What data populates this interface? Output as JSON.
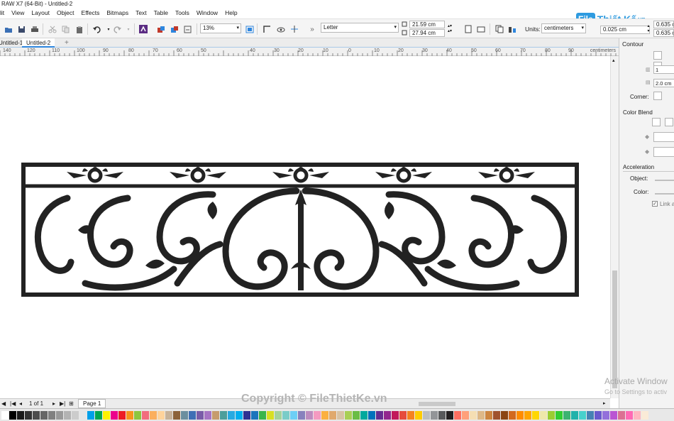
{
  "window": {
    "title": "RAW X7 (64-Bit) - Untitled-2"
  },
  "menu": [
    "lit",
    "View",
    "Layout",
    "Object",
    "Effects",
    "Bitmaps",
    "Text",
    "Table",
    "Tools",
    "Window",
    "Help"
  ],
  "toolbar": {
    "zoom": "13%",
    "paper_size": "Letter",
    "page_width": "21.59 cm",
    "page_height": "27.94 cm",
    "units_label": "Units:",
    "units_value": "centimeters",
    "nudge": "0.025 cm",
    "dup_x": "0.635 cm",
    "dup_y": "0.635 cm",
    "icons": [
      "open-icon",
      "save-icon",
      "print-icon",
      "cut-icon",
      "copy-icon",
      "paste-icon",
      "undo-icon",
      "redo-icon",
      "corel-connect-icon",
      "import-icon",
      "export-icon",
      "publish-pdf-icon",
      "full-screen-icon"
    ]
  },
  "tabs": [
    "Untitled-1",
    "Untitled-2"
  ],
  "ruler": {
    "labels": [
      "140",
      "120",
      "110",
      "100",
      "90",
      "80",
      "70",
      "60",
      "50",
      "40",
      "30",
      "20",
      "10",
      "0",
      "10",
      "20",
      "30",
      "40",
      "50",
      "60",
      "70",
      "80",
      "90"
    ],
    "unit": "centimeters"
  },
  "panel": {
    "title": "Contour",
    "steps": "1",
    "offset": "2.0 cm",
    "corner_label": "Corner:",
    "color_blend_label": "Color Blend",
    "acceleration_label": "Acceleration",
    "object_label": "Object:",
    "color_label": "Color:",
    "link_label": "Link a"
  },
  "pagebar": {
    "page_count": "1 of 1",
    "page_tab": "Page 1"
  },
  "watermark": {
    "activate_title": "Activate Window",
    "activate_sub": "Go to Settings to activ",
    "copyright": "Copyright © FileThietKe.vn",
    "logo_box": "File",
    "logo_text": "Thiết Kế",
    "logo_tld": ".vn"
  },
  "palette": [
    "#ffffff",
    "#000000",
    "#1a1a1a",
    "#333333",
    "#4d4d4d",
    "#666666",
    "#808080",
    "#999999",
    "#b3b3b3",
    "#cccccc",
    "#e6e6e6",
    "#00a0e9",
    "#00a651",
    "#fff200",
    "#ec008c",
    "#ed1c24",
    "#f7941d",
    "#8dc63f",
    "#f26d7d",
    "#fbaf5d",
    "#ffd39b",
    "#c7b299",
    "#8c6239",
    "#6b8e9f",
    "#3f6fb5",
    "#7a5ca8",
    "#a774c4",
    "#c69c6d",
    "#4d9e9b",
    "#27aae1",
    "#00aeef",
    "#2e3192",
    "#1c75bc",
    "#39b54a",
    "#d7df23",
    "#a3d39c",
    "#7accc8",
    "#6dcff6",
    "#8781bd",
    "#bd8cbf",
    "#f49ac1",
    "#fbb040",
    "#e0a96d",
    "#d8c3a5",
    "#a9cf54",
    "#6abd45",
    "#00a99d",
    "#0072bc",
    "#662d91",
    "#92278f",
    "#c2185b",
    "#e64c3c",
    "#f58220",
    "#ffcc00",
    "#bcbec0",
    "#939598",
    "#58595b",
    "#231f20",
    "#ff6f61",
    "#ffa07a",
    "#f5deb3",
    "#deb887",
    "#cd853f",
    "#a0522d",
    "#8b4513",
    "#d2691e",
    "#ff8c00",
    "#ffa500",
    "#ffd700",
    "#eee8aa",
    "#9acd32",
    "#32cd32",
    "#3cb371",
    "#20b2aa",
    "#48d1cc",
    "#4682b4",
    "#6a5acd",
    "#9370db",
    "#ba55d3",
    "#db7093",
    "#ff69b4",
    "#ffb6c1",
    "#faebd7"
  ]
}
